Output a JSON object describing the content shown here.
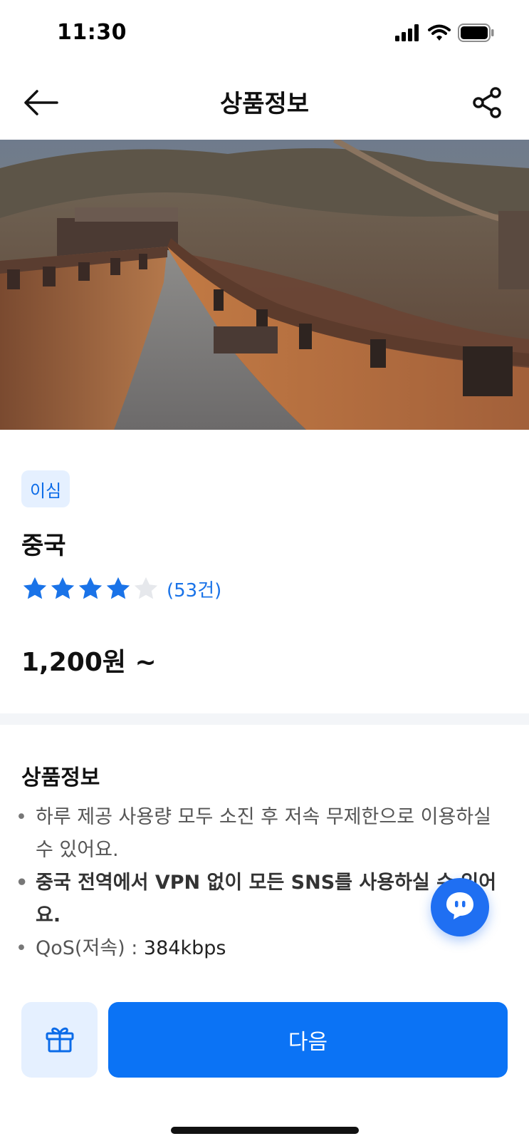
{
  "status_bar": {
    "time": "11:30",
    "icons": [
      "signal-icon",
      "wifi-icon",
      "battery-icon"
    ]
  },
  "nav": {
    "title": "상품정보",
    "back_icon": "arrow-left-icon",
    "share_icon": "share-icon"
  },
  "product": {
    "badge": "이심",
    "name": "중국",
    "rating": {
      "stars_filled": 4,
      "stars_total": 5,
      "count_label": "(53건)"
    },
    "price": "1,200원 ~"
  },
  "info": {
    "title": "상품정보",
    "items": [
      {
        "text": "하루 제공 사용량 모두 소진 후 저속 무제한으로 이용하실 수 있어요.",
        "bold": false
      },
      {
        "text": "중국 전역에서 VPN 없이 모든 SNS를 사용하실 수 있어요.",
        "bold": true
      },
      {
        "label": "QoS(저속) : ",
        "value": "384kbps",
        "bold": false
      }
    ]
  },
  "actions": {
    "gift_icon": "gift-icon",
    "next_label": "다음",
    "chat_icon": "chat-icon"
  },
  "colors": {
    "accent": "#0b73f5",
    "badge_bg": "#e5f0ff",
    "badge_text": "#0b6be8",
    "star_filled": "#1a73e8",
    "star_empty": "#e6e8ec"
  }
}
